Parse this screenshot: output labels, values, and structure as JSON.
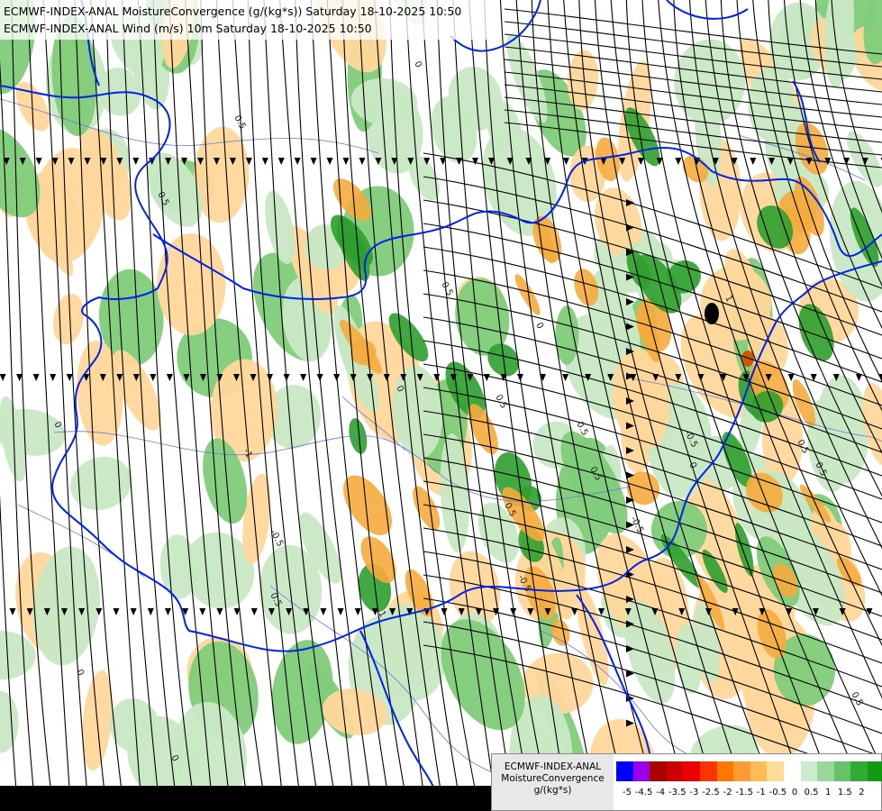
{
  "titles": {
    "line1": "ECMWF-INDEX-ANAL MoistureConvergence (g/(kg*s)) Saturday 18-10-2025 10:50",
    "line2": "ECMWF-INDEX-ANAL Wind (m/s) 10m Saturday 18-10-2025 10:50"
  },
  "legend": {
    "line1": "ECMWF-INDEX-ANAL",
    "line2": "MoistureConvergence",
    "line3": "g/(kg*s)",
    "colors": [
      "#0000ff",
      "#9900ee",
      "#aa0000",
      "#cc0000",
      "#ee0000",
      "#ff3300",
      "#ff7700",
      "#ff9933",
      "#ffbb55",
      "#ffdd99",
      "#ffffff",
      "#ccebcc",
      "#99d699",
      "#66c266",
      "#33aa33",
      "#119911"
    ],
    "ticks": [
      "-5",
      "-4.5",
      "-4",
      "-3.5",
      "-3",
      "-2.5",
      "-2",
      "-1.5",
      "-1",
      "-0.5",
      "0",
      "0.5",
      "1",
      "1.5",
      "2"
    ]
  },
  "map": {
    "contour_labels": [
      "0",
      "0.5",
      "0.5",
      "1",
      "0.5",
      "0",
      "0.5",
      "0",
      "-1",
      "0.5",
      "-0.5",
      "0.5",
      "0",
      "-0.5",
      "0.5",
      "-0.5",
      "0.5",
      "0",
      "0.5",
      "1",
      "0.5",
      "0",
      "-0.5",
      "0.5",
      "0"
    ],
    "field_colors": {
      "background": "#ffffff",
      "green_light": "#c8e8c4",
      "green_mid": "#7fcc7a",
      "green_dark": "#2e9e2e",
      "orange_light": "#ffd79a",
      "orange_mid": "#f5ab3c",
      "dark_spot": "#000000",
      "border": "#0022ee",
      "river": "#6677dd",
      "streamline": "#000000"
    }
  }
}
